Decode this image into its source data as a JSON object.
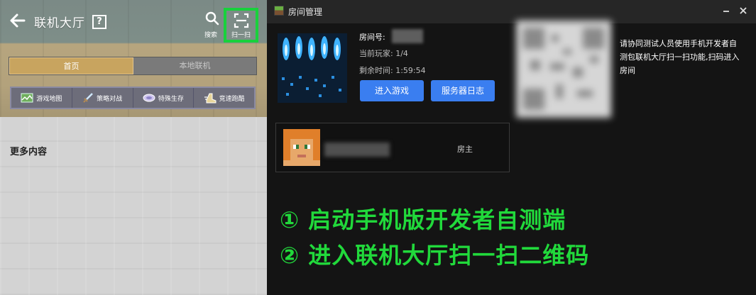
{
  "lobby": {
    "title": "联机大厅",
    "help_icon": "question-box-icon",
    "search_label": "搜索",
    "scan_label": "扫一扫",
    "tabs": [
      {
        "label": "首页",
        "active": true
      },
      {
        "label": "本地联机",
        "active": false
      }
    ],
    "categories": [
      {
        "label": "游戏地图",
        "icon": "map-icon"
      },
      {
        "label": "策略对战",
        "icon": "sword-icon"
      },
      {
        "label": "特殊生存",
        "icon": "survival-icon"
      },
      {
        "label": "竞速跑酷",
        "icon": "boot-icon"
      }
    ],
    "more_title": "更多内容",
    "highlight_color": "#18d13c"
  },
  "dialog": {
    "title": "房间管理",
    "room_id_label": "房间号:",
    "players_text": "当前玩家: 1/4",
    "remaining_text": "剩余时间: 1:59:54",
    "join_button": "进入游戏",
    "log_button": "服务器日志",
    "qr_hint": "请协同测试人员使用手机开发者自测包联机大厅扫一扫功能,扫码进入房间",
    "player": {
      "role": "房主"
    },
    "steps": [
      "① 启动手机版开发者自测端",
      "② 进入联机大厅扫一扫二维码"
    ],
    "button_color": "#3a7ef0",
    "step_color": "#21d93b"
  }
}
